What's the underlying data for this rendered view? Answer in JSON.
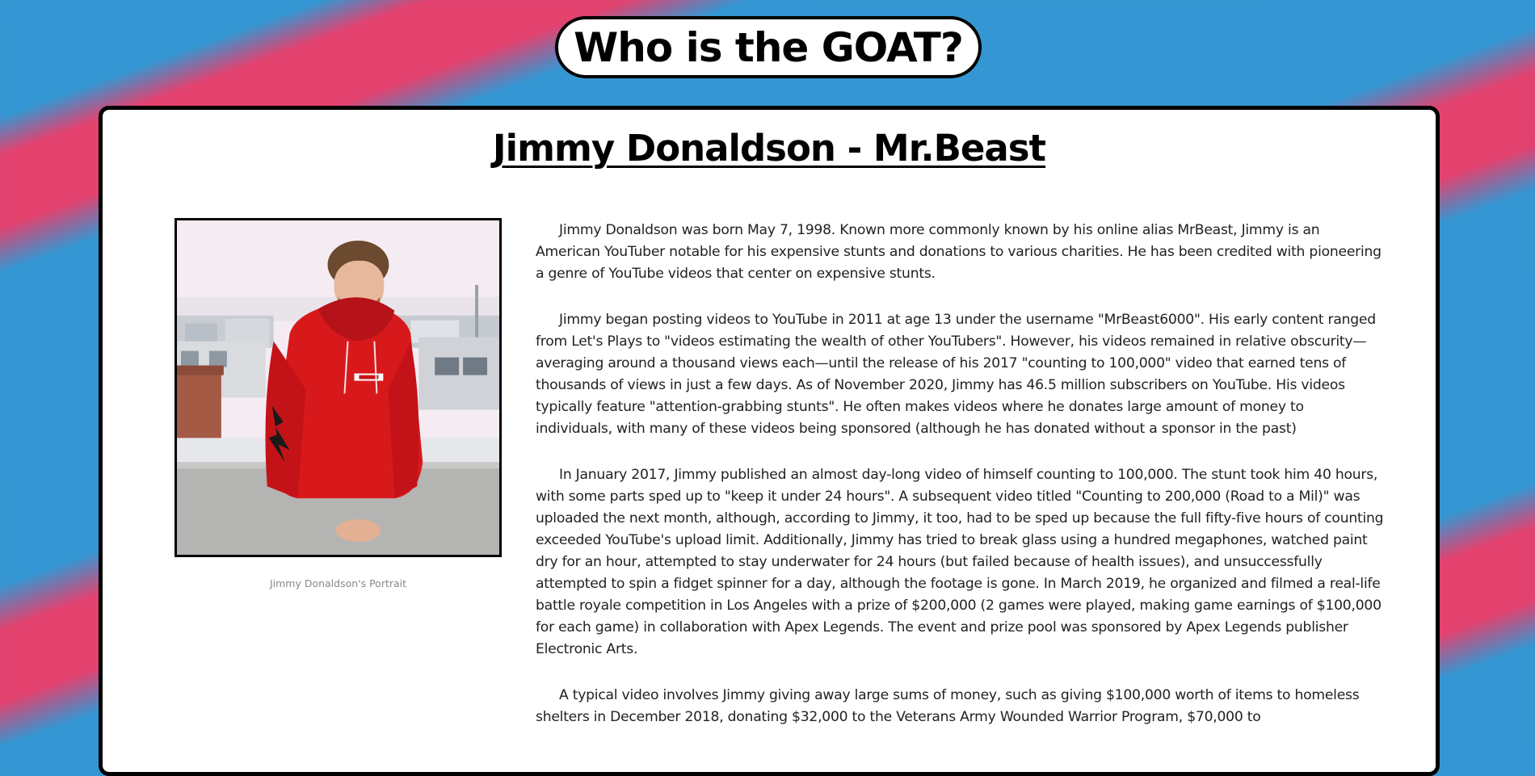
{
  "header": {
    "title": "Who is the GOAT?"
  },
  "profile": {
    "name_heading": "Jimmy Donaldson - Mr.Beast",
    "portrait_caption": "Jimmy Donaldson's Portrait",
    "paragraphs": [
      "Jimmy Donaldson was born May 7, 1998. Known more commonly known by his online alias MrBeast, Jimmy is an American YouTuber notable for his expensive stunts and donations to various charities. He has been credited with pioneering a genre of YouTube videos that center on expensive stunts.",
      "Jimmy began posting videos to YouTube in 2011 at age 13 under the username \"MrBeast6000\". His early content ranged from Let's Plays to \"videos estimating the wealth of other YouTubers\". However, his videos remained in relative obscurity—averaging around a thousand views each—until the release of his 2017 \"counting to 100,000\" video that earned tens of thousands of views in just a few days. As of November 2020, Jimmy has 46.5 million subscribers on YouTube. His videos typically feature \"attention-grabbing stunts\". He often makes videos where he donates large amount of money to individuals, with many of these videos being sponsored (although he has donated without a sponsor in the past)",
      "In January 2017, Jimmy published an almost day-long video of himself counting to 100,000. The stunt took him 40 hours, with some parts sped up to \"keep it under 24 hours\". A subsequent video titled \"Counting to 200,000 (Road to a Mil)\" was uploaded the next month, although, according to Jimmy, it too, had to be sped up because the full fifty-five hours of counting exceeded YouTube's upload limit. Additionally, Jimmy has tried to break glass using a hundred megaphones, watched paint dry for an hour, attempted to stay underwater for 24 hours (but failed because of health issues), and unsuccessfully attempted to spin a fidget spinner for a day, although the footage is gone. In March 2019, he organized and filmed a real-life battle royale competition in Los Angeles with a prize of $200,000 (2 games were played, making game earnings of $100,000 for each game) in collaboration with Apex Legends. The event and prize pool was sponsored by Apex Legends publisher Electronic Arts.",
      "A typical video involves Jimmy giving away large sums of money, such as giving $100,000 worth of items to homeless shelters in December 2018, donating $32,000 to the Veterans Army Wounded Warrior Program, $70,000 to"
    ]
  },
  "colors": {
    "background_blue": "#3497d3",
    "stripe_pink": "#e3416e",
    "card_background": "#ffffff",
    "border": "#000000",
    "caption_gray": "#888888"
  }
}
